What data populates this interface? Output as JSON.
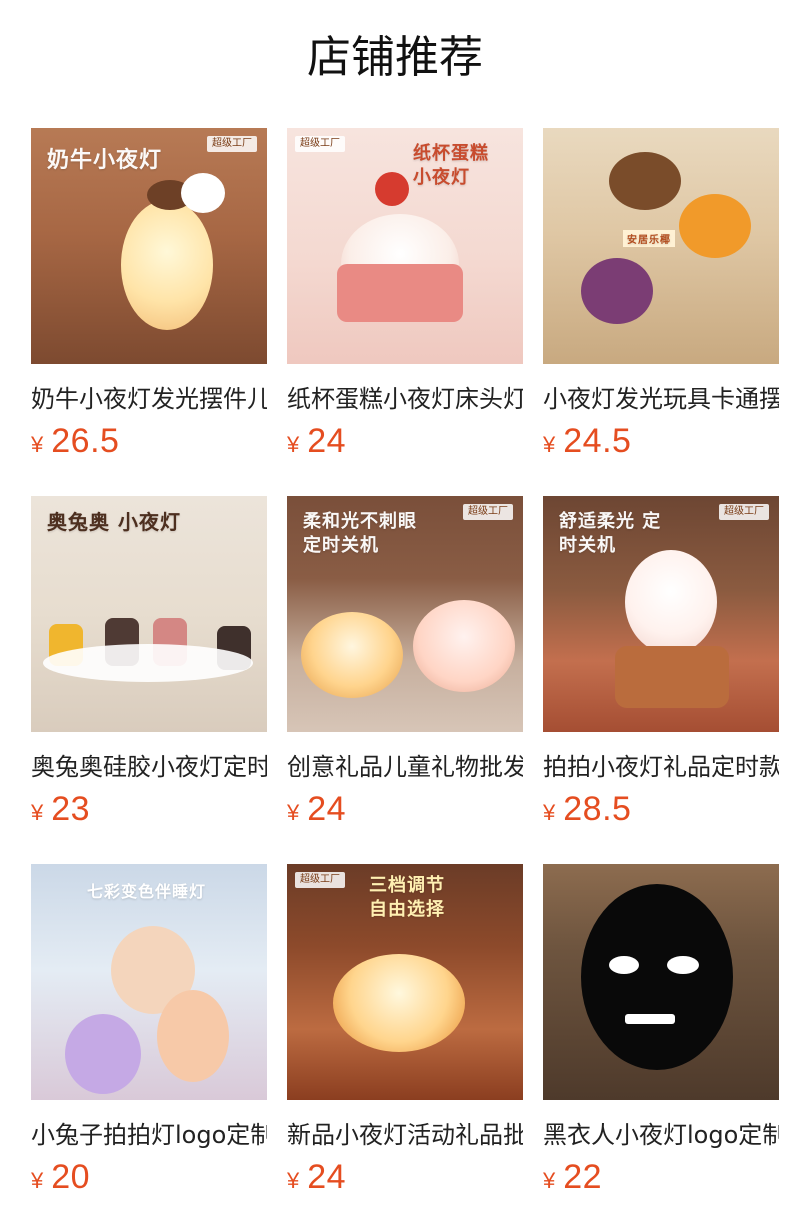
{
  "section": {
    "title": "店铺推荐"
  },
  "products": [
    {
      "title": "奶牛小夜灯发光摆件儿",
      "price": "26.5",
      "currency": "¥",
      "image_text": "奶牛小夜灯"
    },
    {
      "title": "纸杯蛋糕小夜灯床头灯",
      "price": "24",
      "currency": "¥",
      "image_text": "纸杯蛋糕 小夜灯"
    },
    {
      "title": "小夜灯发光玩具卡通摆件",
      "price": "24.5",
      "currency": "¥",
      "image_text": "安居乐椰"
    },
    {
      "title": "奥兔奥硅胶小夜灯定时",
      "price": "23",
      "currency": "¥",
      "image_text": "奥兔奥 小夜灯"
    },
    {
      "title": "创意礼品儿童礼物批发",
      "price": "24",
      "currency": "¥",
      "image_text": "柔和光不刺眼 定时关机"
    },
    {
      "title": "拍拍小夜灯礼品定时款",
      "price": "28.5",
      "currency": "¥",
      "image_text": "舒适柔光 定时关机"
    },
    {
      "title": "小兔子拍拍灯logo定制",
      "price": "20",
      "currency": "¥",
      "image_text": "七彩变色伴睡灯"
    },
    {
      "title": "新品小夜灯活动礼品批发",
      "price": "24",
      "currency": "¥",
      "image_text": "三档调节 自由选择"
    },
    {
      "title": "黑衣人小夜灯logo定制",
      "price": "22",
      "currency": "¥",
      "image_text": ""
    }
  ],
  "theme": {
    "price_color": "#e54d20",
    "title_color": "#222222"
  }
}
